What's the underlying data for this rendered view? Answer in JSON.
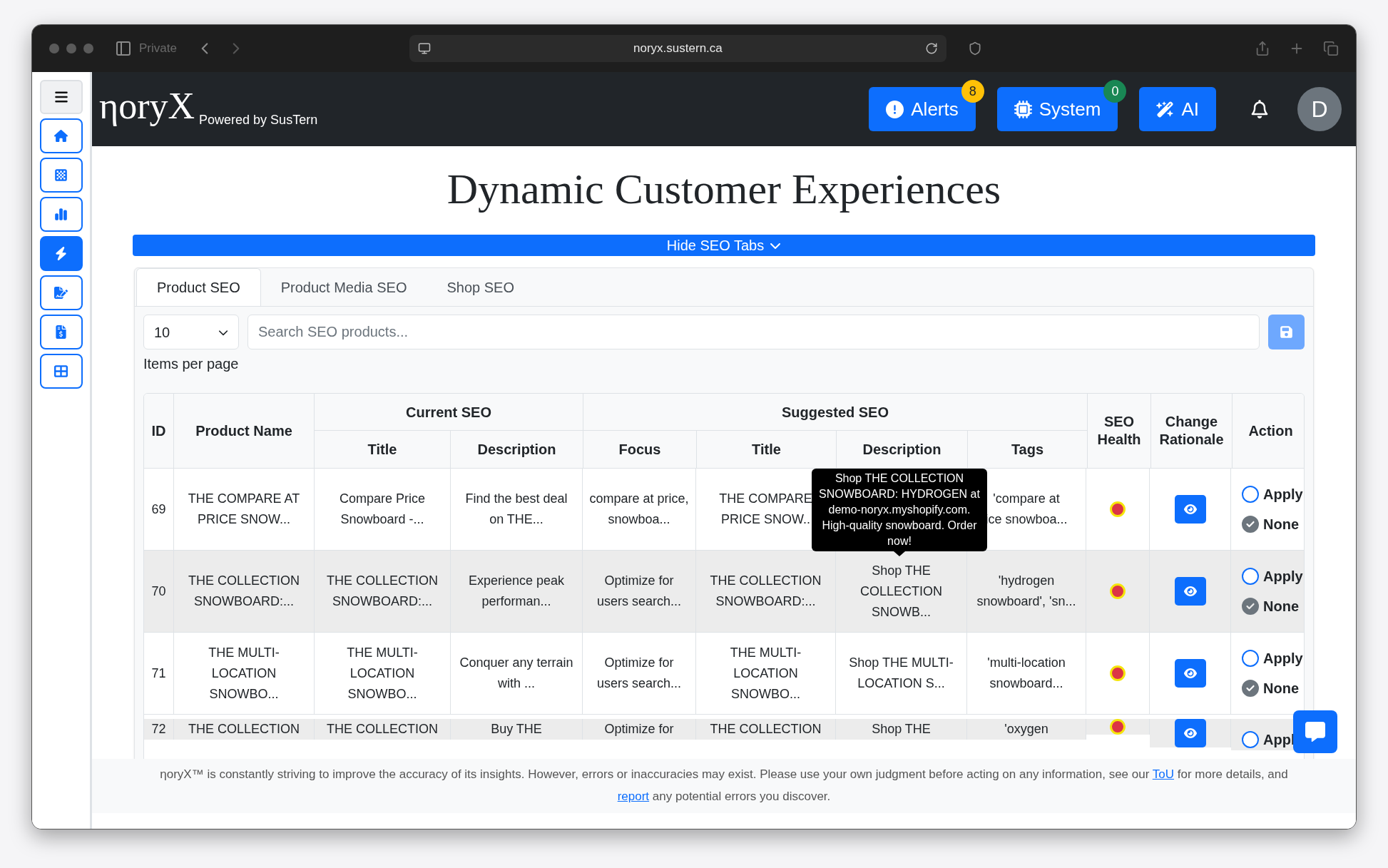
{
  "browser": {
    "private_label": "Private",
    "url": "noryx.sustern.ca"
  },
  "sidebar": {
    "items": [
      {
        "selected": false
      },
      {
        "selected": false
      },
      {
        "selected": false
      },
      {
        "selected": true
      },
      {
        "selected": false
      },
      {
        "selected": false
      },
      {
        "selected": false
      }
    ]
  },
  "header": {
    "logo": "ηoryX",
    "tagline": "Powered by SusTern",
    "buttons": [
      {
        "label": "Alerts",
        "badge": "8",
        "color": "#ffc107"
      },
      {
        "label": "System",
        "badge": "0",
        "color": "#198754"
      },
      {
        "label": "AI"
      }
    ],
    "avatar": "D"
  },
  "page_title": "Dynamic Customer Experiences",
  "toggle_button": "Hide SEO Tabs",
  "tabs": [
    {
      "label": "Product SEO",
      "selected": true
    },
    {
      "label": "Product Media SEO",
      "selected": false
    },
    {
      "label": "Shop SEO",
      "selected": false
    }
  ],
  "page_size": {
    "value": "10",
    "label": "Items per page"
  },
  "search": {
    "placeholder": "Search SEO products..."
  },
  "table": {
    "groups": [
      "Current SEO",
      "Suggested SEO"
    ],
    "columns": {
      "id": "ID",
      "product_name": "Product Name",
      "current": [
        "Title",
        "Description"
      ],
      "suggested": [
        "Focus",
        "Title",
        "Description",
        "Tags"
      ],
      "seo_health": "SEO Health",
      "change_rationale": "Change Rationale",
      "action": "Action"
    },
    "rows": [
      {
        "id": "69",
        "product_name": "THE COMPARE AT PRICE SNOW...",
        "current_title": "Compare Price Snowboard -...",
        "current_description": "Find the best deal on THE...",
        "focus": "compare at price, snowboa...",
        "suggested_title": "THE COMPARE\nPRICE SNOW..",
        "tags": "'compare at\nice snowboa...",
        "color": "#dc3545",
        "actions": [
          {
            "label": "Apply",
            "selected": false
          },
          {
            "label": "None",
            "selected": true
          }
        ]
      },
      {
        "id": "70",
        "product_name": "THE COLLECTION SNOWBOARD:...",
        "current_title": "THE COLLECTION SNOWBOARD:...",
        "current_description": "Experience peak performan...",
        "focus": "Optimize for users search...",
        "suggested_title": "THE COLLECTION SNOWBOARD:...",
        "suggested_description": "Shop THE COLLECTION SNOWB...",
        "tags": "'hydrogen snowboard', 'sn...",
        "color": "#dc3545",
        "actions": [
          {
            "label": "Apply",
            "selected": false
          },
          {
            "label": "None",
            "selected": true
          }
        ]
      },
      {
        "id": "71",
        "product_name": "THE MULTI-LOCATION SNOWBO...",
        "current_title": "THE MULTI-LOCATION SNOWBO...",
        "current_description": "Conquer any terrain with ...",
        "focus": "Optimize for users search...",
        "suggested_title": "THE MULTI-LOCATION SNOWBO...",
        "suggested_description": "Shop THE MULTI-LOCATION S...",
        "tags": "'multi-location snowboard...",
        "color": "#dc3545",
        "actions": [
          {
            "label": "Apply",
            "selected": false
          },
          {
            "label": "None",
            "selected": true
          }
        ]
      },
      {
        "id": "72",
        "product_name": "THE COLLECTION",
        "current_title": "THE COLLECTION",
        "current_description": "Buy THE",
        "focus": "Optimize for",
        "suggested_title": "THE COLLECTION",
        "suggested_description": "Shop THE",
        "tags": "'oxygen",
        "color": "#dc3545",
        "actions": [
          {
            "label": "Appl",
            "selected": false
          }
        ]
      }
    ]
  },
  "tooltip": "Shop THE COLLECTION SNOWBOARD: HYDROGEN at demo-noryx.myshopify.com. High-quality snowboard. Order now!",
  "footer": {
    "text_before": "ηoryX™ is constantly striving to improve the accuracy of its insights. However, errors or inaccuracies may exist. Please use your own judgment before acting on any information, see our",
    "link_terms": "ToU",
    "text_middle": "for more details, and",
    "link_report": "report",
    "text_after": "any potential errors you discover."
  }
}
